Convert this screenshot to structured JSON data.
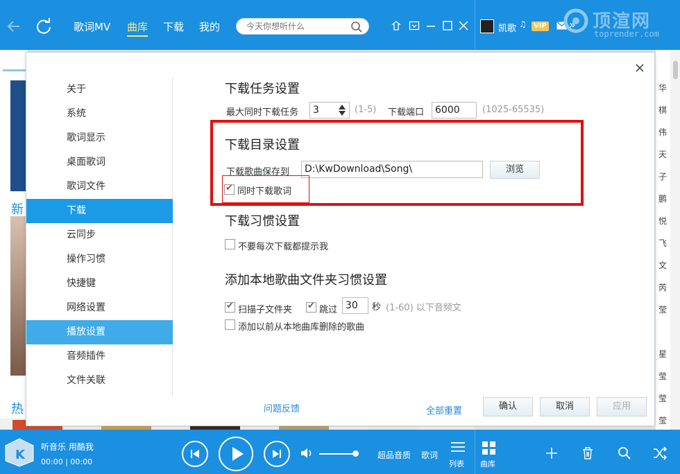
{
  "topbar": {
    "tabs": [
      "歌词MV",
      "曲库",
      "下载",
      "我的"
    ],
    "active_tab": "曲库",
    "search_placeholder": "今天你想听什么",
    "user_name": "凯歌",
    "vip_label": "VIP",
    "accent": "#1b8fe0"
  },
  "watermark": {
    "text": "顶渲网",
    "sub": "toprender.com"
  },
  "background": {
    "heading_new": "新",
    "heading_hot": "热",
    "right_chars": [
      "华",
      "棋",
      "伟",
      "天",
      "子",
      "鹏",
      "悦",
      "飞",
      "文",
      "芮",
      "莹",
      "星",
      "莹",
      "莹",
      "莹"
    ]
  },
  "dialog": {
    "menu": [
      "关于",
      "系统",
      "歌词显示",
      "桌面歌词",
      "歌词文件",
      "下载",
      "云同步",
      "操作习惯",
      "快捷键",
      "网络设置",
      "播放设置",
      "音频插件",
      "文件关联"
    ],
    "active_item": "下载",
    "task": {
      "title": "下载任务设置",
      "max_label": "最大同时下载任务",
      "max_value": "3",
      "max_range": "(1-5)",
      "port_label": "下载端口",
      "port_value": "6000",
      "port_range": "(1025-65535)"
    },
    "directory": {
      "title": "下载目录设置",
      "save_label": "下载歌曲保存到",
      "path": "D:\\KwDownload\\Song\\",
      "browse": "浏览",
      "lyrics_label": "同时下载歌词",
      "lyrics_checked": true
    },
    "habit": {
      "title": "下载习惯设置",
      "no_prompt_label": "不要每次下载都提示我",
      "no_prompt_checked": false
    },
    "local": {
      "title": "添加本地歌曲文件夹习惯设置",
      "scan_label": "扫描子文件夹",
      "scan_checked": true,
      "skip_label": "跳过",
      "skip_checked": true,
      "skip_value": "30",
      "sec_label": "秒",
      "skip_hint": "(1-60) 以下音频文",
      "deleted_label": "添加以前从本地曲库删除的歌曲",
      "deleted_checked": false
    },
    "feedback": "问题反馈",
    "reset": "全部重置",
    "confirm": "确认",
    "cancel": "取消",
    "apply": "应用"
  },
  "player": {
    "title": "听音乐 用酷我",
    "time": "00:00 | 00:00",
    "quality": "超品音质",
    "lyrics": "歌词",
    "list": "列表",
    "library": "曲库"
  }
}
